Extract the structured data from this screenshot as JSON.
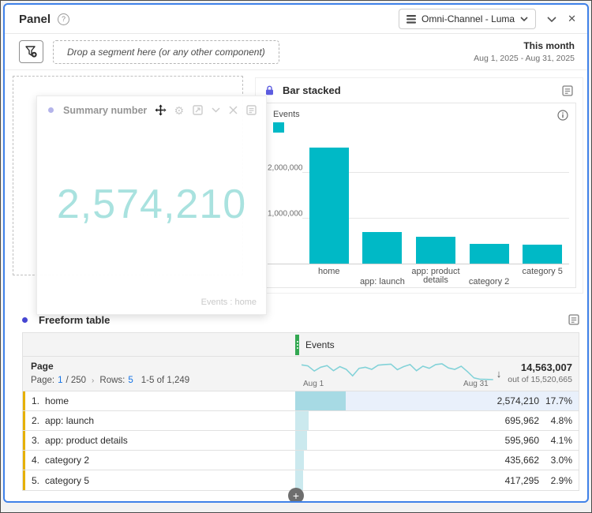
{
  "panel": {
    "title": "Panel",
    "help_icon": "?",
    "data_source": {
      "label": "Omni-Channel - Luma"
    },
    "segment_drop_placeholder": "Drop a segment here (or any other component)",
    "date_preset": "This month",
    "date_range": "Aug 1, 2025 - Aug 31, 2025",
    "close_glyph": "✕"
  },
  "summary_number": {
    "title": "Summary number",
    "value": "2,574,210",
    "caption": "Events : home",
    "gear_glyph": "⚙"
  },
  "bar_chart": {
    "title": "Bar stacked",
    "legend_label": "Events"
  },
  "chart_data": [
    {
      "type": "bar",
      "title": "Bar stacked",
      "categories": [
        "home",
        "app: launch",
        "app: product details",
        "category 2",
        "category 5"
      ],
      "series": [
        {
          "name": "Events",
          "values": [
            2574210,
            695962,
            595960,
            435662,
            417295
          ]
        }
      ],
      "yticks": [
        1000000,
        2000000
      ],
      "ytick_labels": [
        "1,000,000",
        "2,000,000"
      ],
      "ylim": [
        0,
        2860000
      ],
      "legend": [
        "Events"
      ],
      "legend_position": "top-left",
      "grid": true,
      "color": "#00b9c6"
    },
    {
      "type": "line",
      "name": "Events by day (sparkline)",
      "x_start_label": "Aug 1",
      "x_end_label": "Aug 31",
      "approx_daily_events_thousands": [
        520,
        505,
        430,
        485,
        510,
        435,
        495,
        455,
        360,
        470,
        485,
        455,
        515,
        525,
        530,
        450,
        495,
        525,
        435,
        500,
        470,
        525,
        535,
        475,
        455,
        500,
        420,
        330,
        310,
        308,
        305
      ],
      "color": "#82d2d8"
    }
  ],
  "freeform_table": {
    "title": "Freeform table",
    "column_header": "Events",
    "dimension_header": "Page",
    "pagination": {
      "page_label": "Page:",
      "page": "1",
      "of": "/ 250",
      "next_glyph": "›",
      "rows_label": "Rows:",
      "rows": "5",
      "range": "1-5 of 1,249"
    },
    "sort_glyph": "↓",
    "total": {
      "value": "14,563,007",
      "out_of": "out of 15,520,665"
    },
    "rows": [
      {
        "rank": "1.",
        "name": "home",
        "value": "2,574,210",
        "pct": "17.7%",
        "bar_pct": 17.7,
        "highlight": true
      },
      {
        "rank": "2.",
        "name": "app: launch",
        "value": "695,962",
        "pct": "4.8%",
        "bar_pct": 4.8,
        "highlight": false
      },
      {
        "rank": "3.",
        "name": "app: product details",
        "value": "595,960",
        "pct": "4.1%",
        "bar_pct": 4.1,
        "highlight": false
      },
      {
        "rank": "4.",
        "name": "category 2",
        "value": "435,662",
        "pct": "3.0%",
        "bar_pct": 3.0,
        "highlight": false
      },
      {
        "rank": "5.",
        "name": "category 5",
        "value": "417,295",
        "pct": "2.9%",
        "bar_pct": 2.9,
        "highlight": false
      }
    ],
    "add_button_glyph": "+"
  },
  "colors": {
    "selection_blue": "#3f81e8",
    "teal": "#00b9c6",
    "light_teal_number": "#a9e2df",
    "spark_teal": "#82d2d8",
    "row_fill_teal": "#a7dae4",
    "row_highlight": "#e9f0fb",
    "yellow_row_border": "#e6b000",
    "green_handle": "#33a852",
    "indigo_dot": "#4646d2",
    "purple_lock": "#5c5ce0",
    "link_blue": "#1473e6"
  }
}
